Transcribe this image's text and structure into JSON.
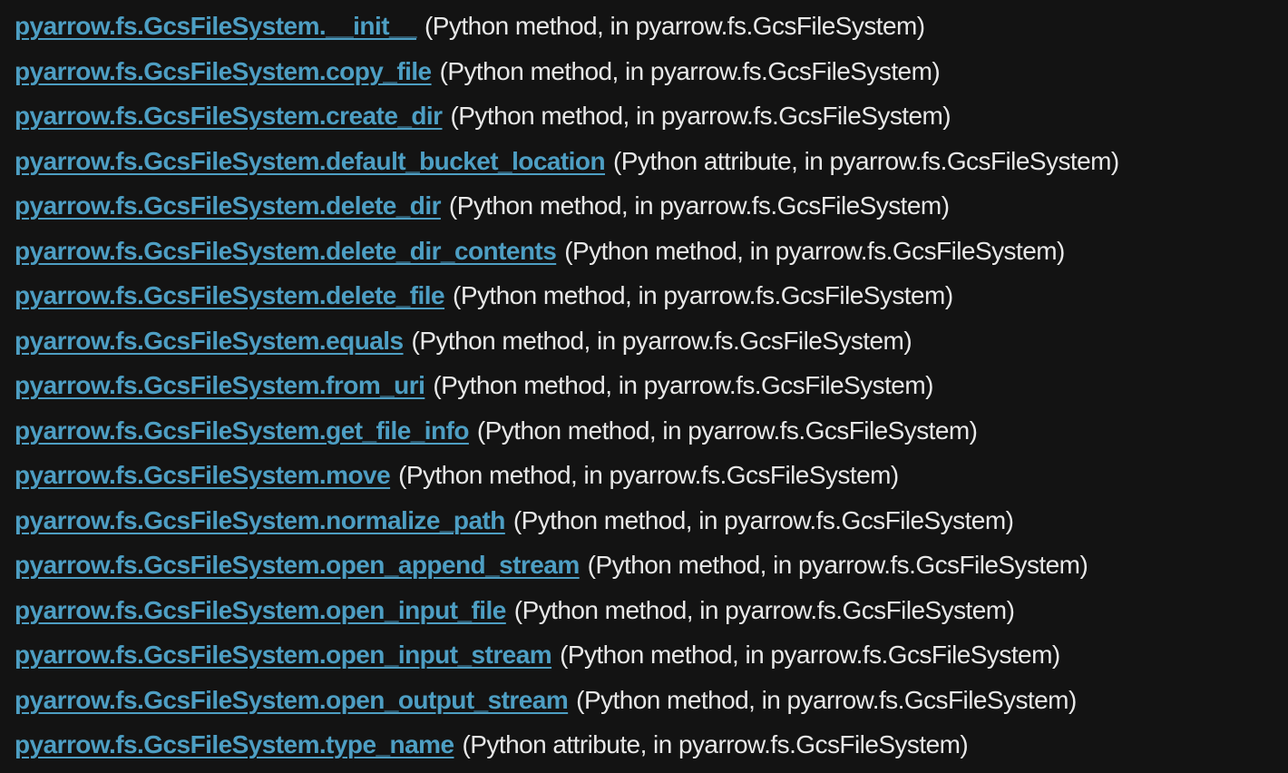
{
  "colors": {
    "background": "#131313",
    "link": "#4d9ec3",
    "text": "#e8e8e8"
  },
  "entries": [
    {
      "name": "pyarrow.fs.GcsFileSystem.__init__",
      "desc": "(Python method, in pyarrow.fs.GcsFileSystem)"
    },
    {
      "name": "pyarrow.fs.GcsFileSystem.copy_file",
      "desc": "(Python method, in pyarrow.fs.GcsFileSystem)"
    },
    {
      "name": "pyarrow.fs.GcsFileSystem.create_dir",
      "desc": "(Python method, in pyarrow.fs.GcsFileSystem)"
    },
    {
      "name": "pyarrow.fs.GcsFileSystem.default_bucket_location",
      "desc": "(Python attribute, in pyarrow.fs.GcsFileSystem)"
    },
    {
      "name": "pyarrow.fs.GcsFileSystem.delete_dir",
      "desc": "(Python method, in pyarrow.fs.GcsFileSystem)"
    },
    {
      "name": "pyarrow.fs.GcsFileSystem.delete_dir_contents",
      "desc": "(Python method, in pyarrow.fs.GcsFileSystem)"
    },
    {
      "name": "pyarrow.fs.GcsFileSystem.delete_file",
      "desc": "(Python method, in pyarrow.fs.GcsFileSystem)"
    },
    {
      "name": "pyarrow.fs.GcsFileSystem.equals",
      "desc": "(Python method, in pyarrow.fs.GcsFileSystem)"
    },
    {
      "name": "pyarrow.fs.GcsFileSystem.from_uri",
      "desc": "(Python method, in pyarrow.fs.GcsFileSystem)"
    },
    {
      "name": "pyarrow.fs.GcsFileSystem.get_file_info",
      "desc": "(Python method, in pyarrow.fs.GcsFileSystem)"
    },
    {
      "name": "pyarrow.fs.GcsFileSystem.move",
      "desc": "(Python method, in pyarrow.fs.GcsFileSystem)"
    },
    {
      "name": "pyarrow.fs.GcsFileSystem.normalize_path",
      "desc": "(Python method, in pyarrow.fs.GcsFileSystem)"
    },
    {
      "name": "pyarrow.fs.GcsFileSystem.open_append_stream",
      "desc": "(Python method, in pyarrow.fs.GcsFileSystem)"
    },
    {
      "name": "pyarrow.fs.GcsFileSystem.open_input_file",
      "desc": "(Python method, in pyarrow.fs.GcsFileSystem)"
    },
    {
      "name": "pyarrow.fs.GcsFileSystem.open_input_stream",
      "desc": "(Python method, in pyarrow.fs.GcsFileSystem)"
    },
    {
      "name": "pyarrow.fs.GcsFileSystem.open_output_stream",
      "desc": "(Python method, in pyarrow.fs.GcsFileSystem)"
    },
    {
      "name": "pyarrow.fs.GcsFileSystem.type_name",
      "desc": "(Python attribute, in pyarrow.fs.GcsFileSystem)"
    }
  ]
}
